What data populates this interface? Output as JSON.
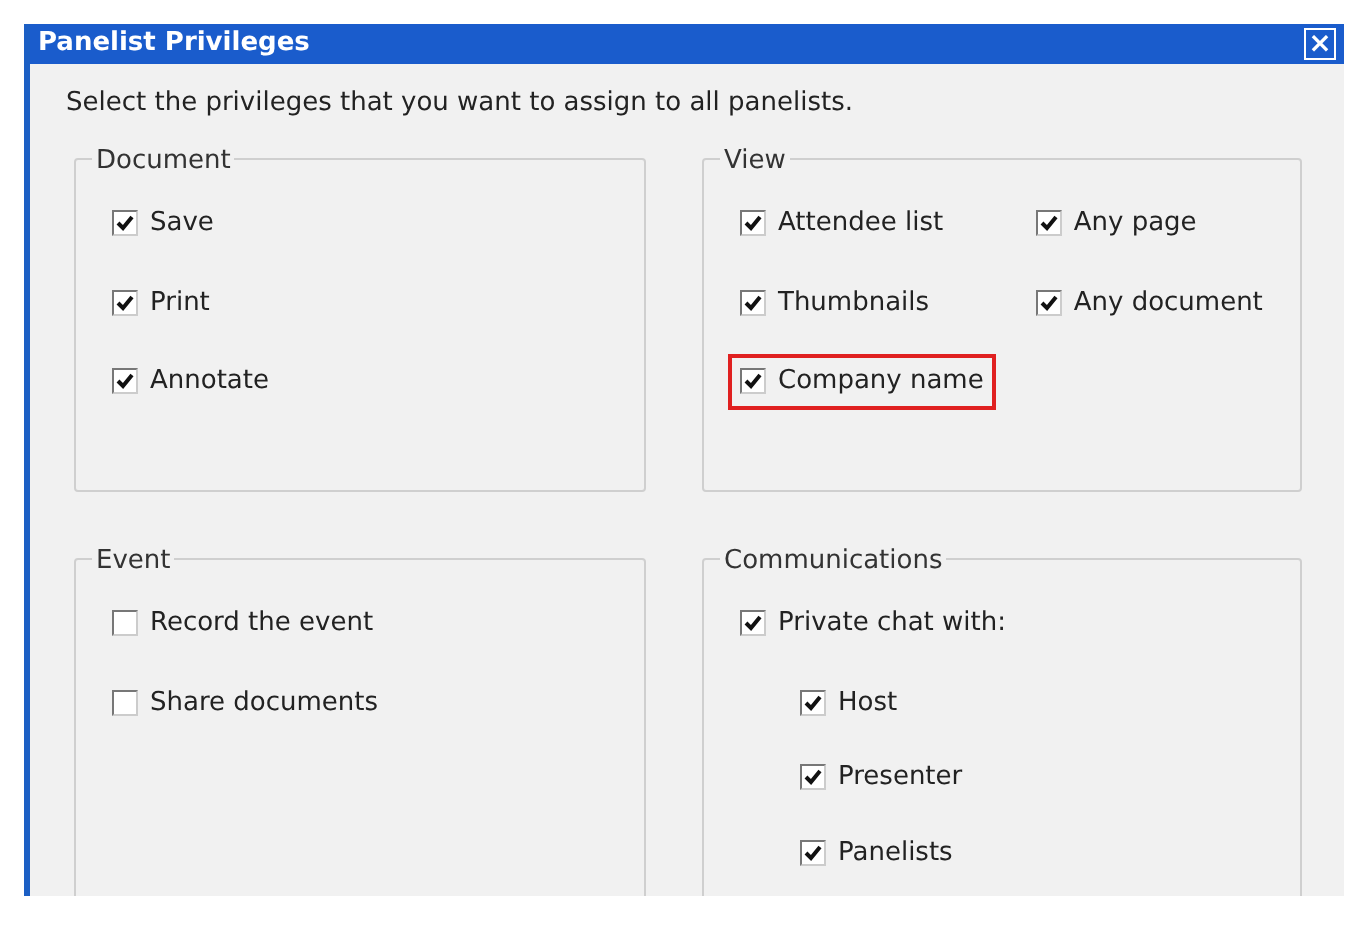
{
  "window": {
    "title": "Panelist Privileges",
    "close_glyph": "×"
  },
  "instruction": "Select the privileges that you want to assign to all panelists.",
  "groups": [
    {
      "title": "Document",
      "kind": "list",
      "items": [
        {
          "label": "Save",
          "checked": true,
          "highlighted": false
        },
        {
          "label": "Print",
          "checked": true,
          "highlighted": false
        },
        {
          "label": "Annotate",
          "checked": true,
          "highlighted": false
        }
      ]
    },
    {
      "title": "View",
      "kind": "grid",
      "items": [
        {
          "label": "Attendee list",
          "checked": true,
          "highlighted": false
        },
        {
          "label": "Any page",
          "checked": true,
          "highlighted": false
        },
        {
          "label": "Thumbnails",
          "checked": true,
          "highlighted": false
        },
        {
          "label": "Any document",
          "checked": true,
          "highlighted": false
        },
        {
          "label": "Company name",
          "checked": true,
          "highlighted": true
        }
      ]
    },
    {
      "title": "Event",
      "kind": "list",
      "items": [
        {
          "label": "Record the event",
          "checked": false,
          "highlighted": false
        },
        {
          "label": "Share documents",
          "checked": false,
          "highlighted": false
        }
      ]
    },
    {
      "title": "Communications",
      "kind": "list",
      "items": [
        {
          "label": "Private chat with:",
          "checked": true,
          "highlighted": false,
          "children": [
            {
              "label": "Host",
              "checked": true,
              "highlighted": false
            },
            {
              "label": "Presenter",
              "checked": true,
              "highlighted": false
            },
            {
              "label": "Panelists",
              "checked": true,
              "highlighted": false
            }
          ]
        }
      ]
    }
  ]
}
